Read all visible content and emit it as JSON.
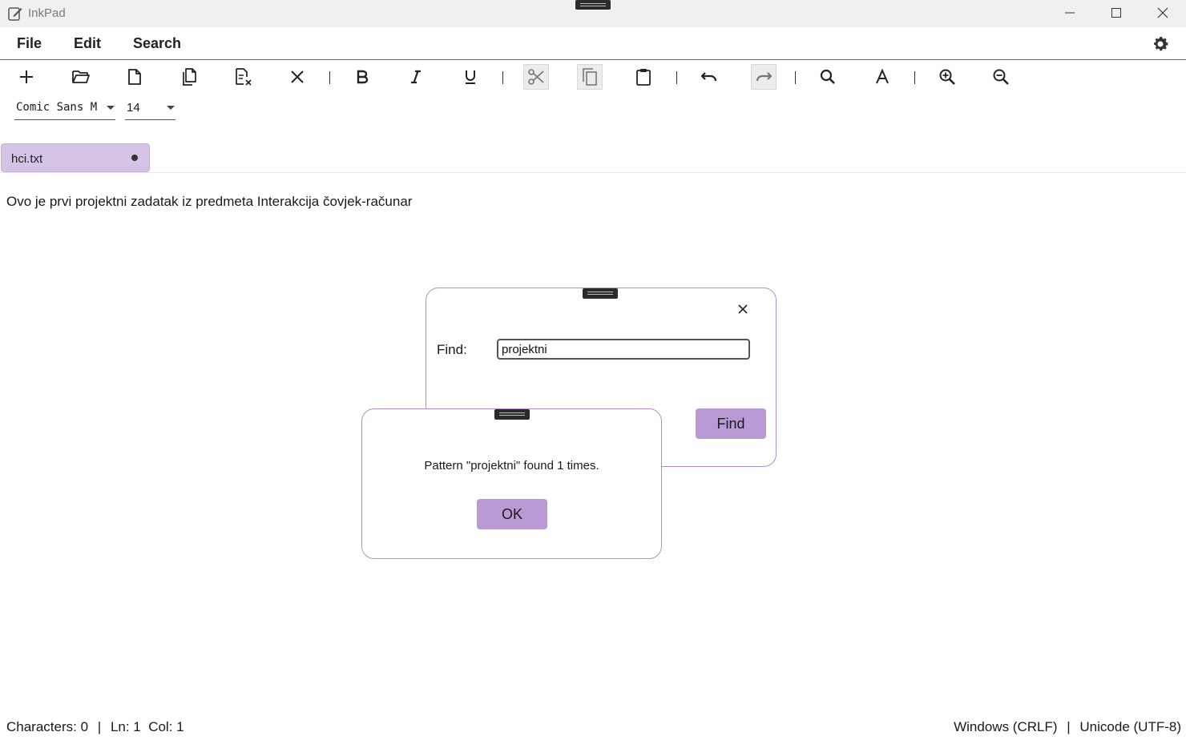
{
  "window": {
    "title": "InkPad"
  },
  "menu": {
    "file": "File",
    "edit": "Edit",
    "search": "Search"
  },
  "toolbar": {
    "icons": [
      "plus-icon",
      "folder-open-icon",
      "new-file-icon",
      "copy-file-icon",
      "file-close-icon",
      "close-icon",
      "bold-icon",
      "italic-icon",
      "underline-icon",
      "cut-icon",
      "copy-icon",
      "paste-icon",
      "undo-icon",
      "redo-icon",
      "search-icon",
      "font-icon",
      "zoom-in-icon",
      "zoom-out-icon"
    ],
    "font_name": "Comic Sans M",
    "font_size": "14"
  },
  "tabs": [
    {
      "label": "hci.txt",
      "modified": true
    }
  ],
  "editor": {
    "content": "Ovo je prvi projektni zadatak iz predmeta Interakcija čovjek-računar"
  },
  "find_dialog": {
    "find_label": "Find:",
    "find_value": "projektni",
    "find_button": "Find"
  },
  "message_dialog": {
    "message": "Pattern \"projektni\" found 1 times.",
    "ok_button": "OK"
  },
  "status": {
    "characters": "Characters: 0",
    "sep": "|",
    "position": "Ln: 1  Col: 1",
    "line_ending": "Windows (CRLF)",
    "encoding": "Unicode (UTF-8)"
  },
  "colors": {
    "accent": "#b99ad4",
    "tab_bg": "#d5c3e6",
    "dialog_border": "#b28fcc"
  }
}
